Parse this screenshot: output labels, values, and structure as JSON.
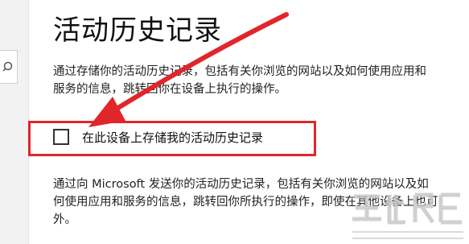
{
  "window": {
    "title": "活动历史记录"
  },
  "description_local": {
    "lines": [
      "通过存储你的活动历史记录，包括有关你浏览的网站以及如何使用应用和",
      "服务的信息，跳转回你在设备上执行的操作。"
    ]
  },
  "store_history_checkbox": {
    "label": "在此设备上存储我的活动历史记录",
    "checked": false
  },
  "description_cloud": {
    "lines": [
      "通过向 Microsoft 发送你的活动历史记录，包括有关你浏览的网站以及如",
      "何使用应用和服务的信息，跳转回你所执行的操作，即使在其他设备上也可",
      "外。"
    ]
  },
  "annotation": {
    "highlight_color": "#e0262a",
    "arrow_color": "#e0262a"
  },
  "icons": {
    "search": "search-icon",
    "watermark": "watermark-logo"
  }
}
